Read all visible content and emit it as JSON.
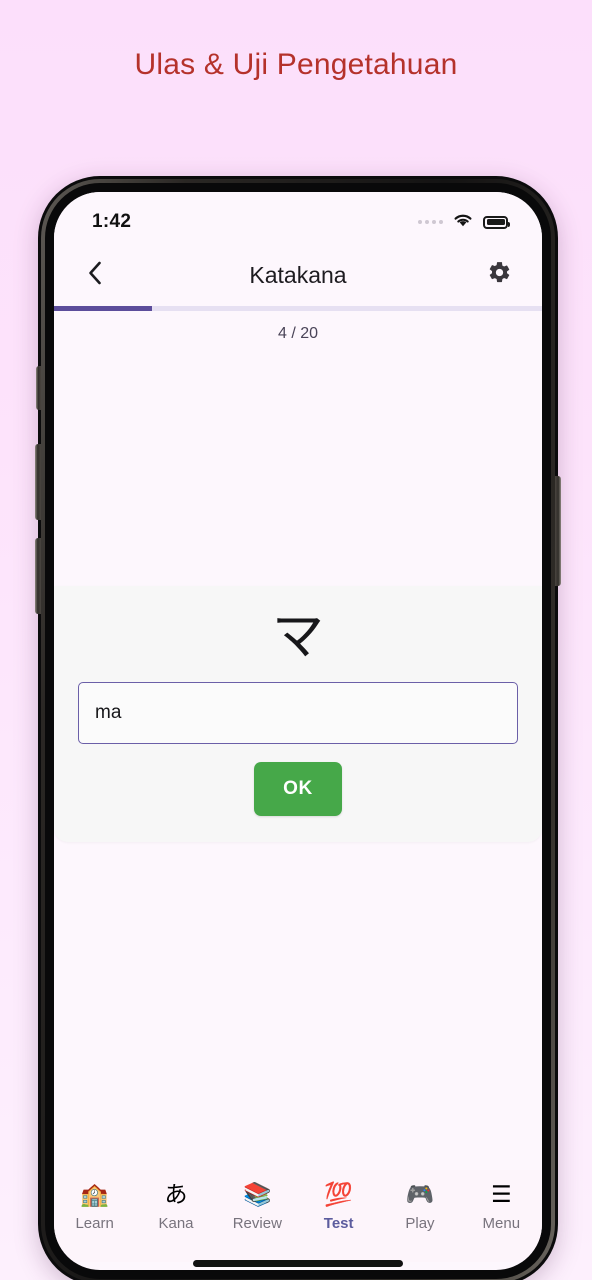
{
  "page": {
    "title": "Ulas & Uji Pengetahuan",
    "title_color": "#b5322b",
    "background_color": "#fcdffb"
  },
  "status_bar": {
    "time": "1:42",
    "signal_icon": "signal-dots-icon",
    "wifi_icon": "wifi-icon",
    "battery_icon": "battery-full-icon"
  },
  "app_bar": {
    "back_icon": "chevron-left-icon",
    "title": "Katakana",
    "settings_icon": "gear-icon"
  },
  "progress": {
    "current": 4,
    "total": 20,
    "label": "4 / 20",
    "percent": 20,
    "fill_color": "#5c4d9b",
    "track_color": "#e6e0f2"
  },
  "quiz": {
    "kana_character": "マ",
    "kana_romaji": "ma",
    "answer_value": "ma",
    "answer_placeholder": "",
    "submit_label": "OK",
    "submit_color": "#46a849",
    "input_border_color": "#6b5fa8"
  },
  "bottom_nav": {
    "active_color": "#5c5c9e",
    "inactive_color": "#78737d",
    "items": [
      {
        "label": "Learn",
        "icon": "school-icon",
        "glyph": "🏫",
        "active": false
      },
      {
        "label": "Kana",
        "icon": "hiragana-a-icon",
        "glyph": "あ",
        "active": false
      },
      {
        "label": "Review",
        "icon": "books-icon",
        "glyph": "📚",
        "active": false
      },
      {
        "label": "Test",
        "icon": "hundred-points-icon",
        "glyph": "💯",
        "active": true
      },
      {
        "label": "Play",
        "icon": "game-controller-icon",
        "glyph": "🎮",
        "active": false
      },
      {
        "label": "Menu",
        "icon": "hamburger-menu-icon",
        "glyph": "☰",
        "active": false
      }
    ]
  }
}
